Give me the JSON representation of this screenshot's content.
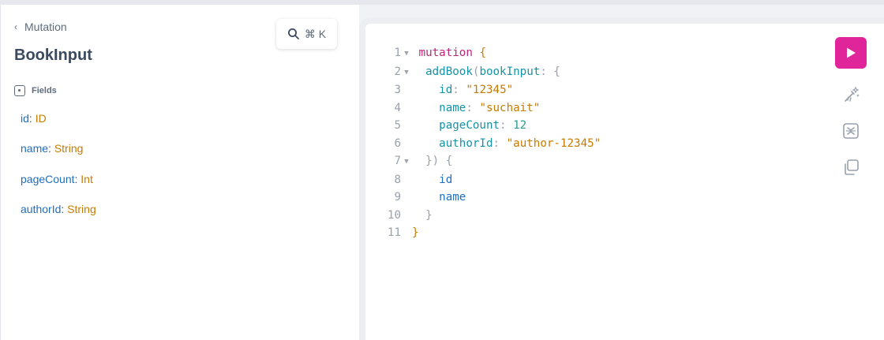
{
  "breadcrumb": {
    "back_label": "Mutation"
  },
  "doc": {
    "title": "BookInput",
    "section_label": "Fields",
    "fields": [
      {
        "name": "id",
        "type": "ID"
      },
      {
        "name": "name",
        "type": "String"
      },
      {
        "name": "pageCount",
        "type": "Int"
      },
      {
        "name": "authorId",
        "type": "String"
      }
    ]
  },
  "search": {
    "shortcut": "⌘ K"
  },
  "editor": {
    "line_numbers": [
      "1",
      "2",
      "3",
      "4",
      "5",
      "6",
      "7",
      "8",
      "9",
      "10",
      "11"
    ],
    "code": {
      "l1_kw": "mutation",
      "l1_brace": "{",
      "l2_fn": "addBook",
      "l2_open": "(",
      "l2_arg": "bookInput",
      "l2_colon": ":",
      "l2_brace": "{",
      "l3_key": "id",
      "l3_val": "\"12345\"",
      "l4_key": "name",
      "l4_val": "\"suchait\"",
      "l5_key": "pageCount",
      "l5_val": "12",
      "l6_key": "authorId",
      "l6_val": "\"author-12345\"",
      "l7_close": "}) {",
      "l8_sel": "id",
      "l9_sel": "name",
      "l10_close": "}",
      "l11_close": "}"
    }
  },
  "icons": {
    "run": "play-icon",
    "prettify": "prettify-icon",
    "merge": "merge-fragments-icon",
    "copy": "copy-icon"
  },
  "colors": {
    "accent": "#e0249a",
    "field_name": "#1f6fbf",
    "type_name": "#c77b00",
    "keyword": "#c0257a"
  }
}
